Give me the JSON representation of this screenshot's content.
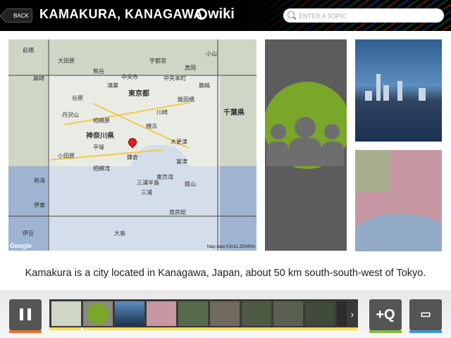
{
  "header": {
    "back_label": "BACK",
    "title": "KAMAKURA, KANAGAWA",
    "logo_text": "wiki",
    "search_placeholder": "ENTER A TOPIC"
  },
  "map": {
    "labels": [
      "大田原",
      "宇都宮",
      "真岡",
      "前橋",
      "高崎",
      "小山",
      "熊谷",
      "鴻巣",
      "中央市",
      "中央本町",
      "鹿嶋",
      "東京都",
      "飯田橋",
      "谷原",
      "丹沢山",
      "相模原",
      "千葉県",
      "神奈川県",
      "川崎",
      "平塚",
      "横浜",
      "鎌倉",
      "小田原",
      "相模湾",
      "三浦",
      "木更津",
      "富津",
      "館山",
      "東京湾",
      "南房総",
      "熱海",
      "伊東",
      "大島",
      "三浦半島",
      "伊豆",
      "Google"
    ],
    "provinces": [
      "東京都",
      "神奈川県",
      "千葉県"
    ],
    "credit": "Map data ©2011 ZENRIN",
    "attribution": "Google"
  },
  "caption": "Kamakura is a city located in Kanagawa, Japan, about 50 km south-south-west of Tokyo.",
  "colors": {
    "header_bg": "#000000",
    "accent_orange": "#e8742a",
    "accent_yellow": "#f4e24a",
    "accent_green": "#7fbf3f",
    "accent_blue": "#3a9ad9",
    "people_green": "#7aa62a"
  },
  "icons": {
    "back": "back-arrow-icon",
    "search": "search-icon",
    "pause": "pause-icon",
    "add_q": "add-qwiki-icon",
    "comment": "comment-icon",
    "next": "chevron-right-icon"
  }
}
